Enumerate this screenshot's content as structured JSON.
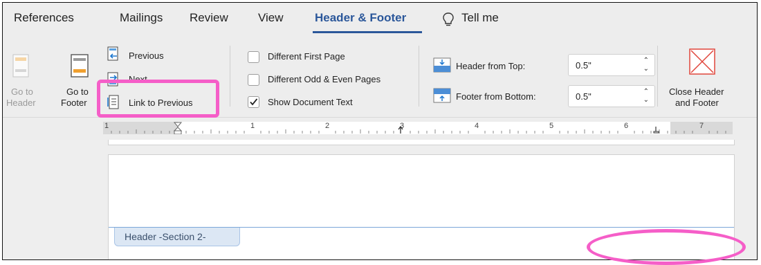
{
  "tabs": [
    {
      "label": "References"
    },
    {
      "label": "Mailings"
    },
    {
      "label": "Review"
    },
    {
      "label": "View"
    },
    {
      "label": "Header & Footer",
      "active": true
    },
    {
      "label": "Tell me"
    }
  ],
  "navigation": {
    "go_to_header": [
      "Go to",
      "Header"
    ],
    "go_to_footer": [
      "Go to",
      "Footer"
    ],
    "previous": "Previous",
    "next": "Next",
    "link_to_previous": "Link to Previous"
  },
  "options": {
    "different_first_page": {
      "label": "Different First Page",
      "checked": false
    },
    "different_odd_even": {
      "label": "Different Odd & Even Pages",
      "checked": false
    },
    "show_document_text": {
      "label": "Show Document Text",
      "checked": true
    }
  },
  "position": {
    "header_from_top": {
      "label": "Header from Top:",
      "value": "0.5\""
    },
    "footer_from_bottom": {
      "label": "Footer from Bottom:",
      "value": "0.5\""
    }
  },
  "close": {
    "line1": "Close Header",
    "line2": "and Footer"
  },
  "ruler": {
    "numbers": [
      "1",
      "1",
      "2",
      "3",
      "4",
      "5",
      "6",
      "7"
    ]
  },
  "document": {
    "header_label": "Header -Section 2-"
  },
  "colors": {
    "accent": "#2b579a",
    "highlight": "#f55ec8",
    "close_red": "#e0443a"
  }
}
